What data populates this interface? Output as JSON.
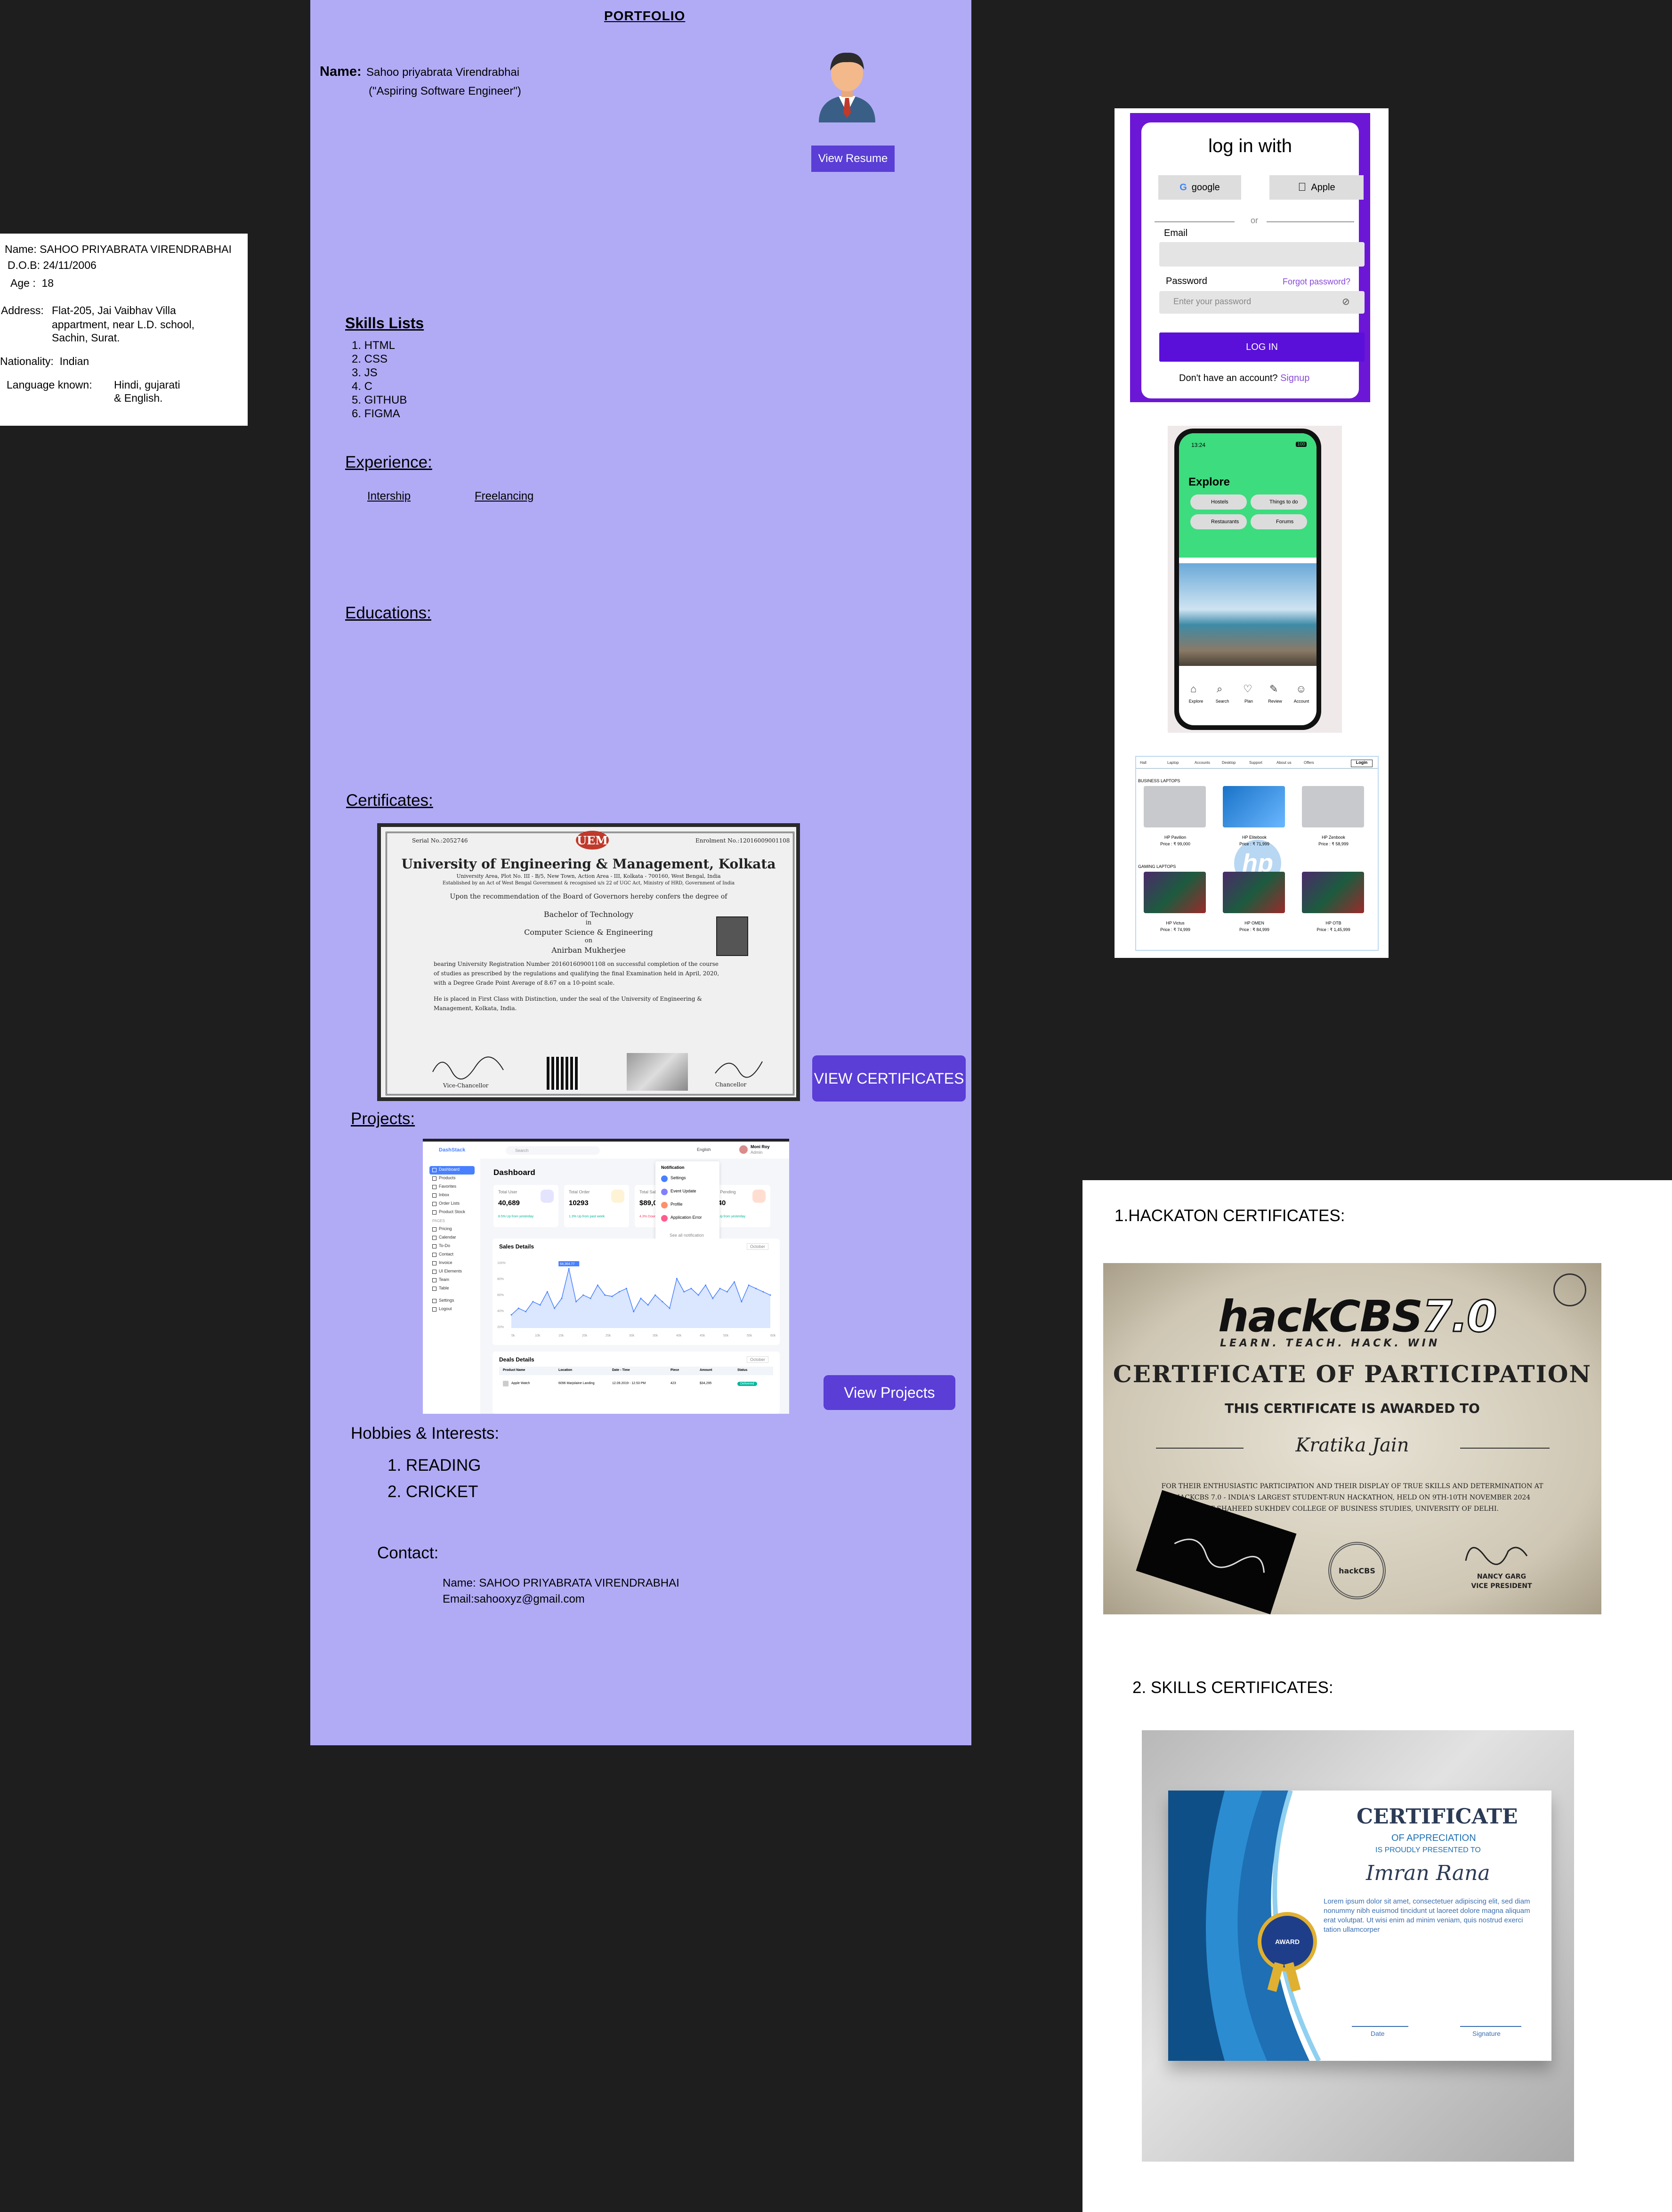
{
  "info": {
    "name_label": "Name:",
    "name_value": "SAHOO PRIYABRATA VIRENDRABHAI",
    "dob_label": "D.O.B:",
    "dob_value": "24/11/2006",
    "age_label": "Age :",
    "age_value": "18",
    "address_label": "Address:",
    "address_line1": "Flat-205, Jai Vaibhav Villa",
    "address_line2": "appartment, near L.D. school,",
    "address_line3": "Sachin, Surat.",
    "nationality_label": "Nationality:",
    "nationality_value": "Indian",
    "language_label": "Language known:",
    "language_line1": "Hindi, gujarati",
    "language_line2": "& English."
  },
  "portfolio": {
    "title": "PORTFOLIO",
    "name_label": "Name:",
    "name_value": "Sahoo priyabrata Virendrabhai",
    "tagline": "(\"Aspiring Software Engineer\")",
    "view_resume": "View Resume",
    "skills_heading": "Skills Lists",
    "skills": [
      "1. HTML",
      "2. CSS",
      "3. JS",
      "4. C",
      "5. GITHUB",
      "6. FIGMA"
    ],
    "experience_heading": "Experience:",
    "experience_items": [
      "Intership",
      "Freelancing"
    ],
    "education_heading": "Educations:",
    "certificates_heading": "Certificates:",
    "view_certificates": "VIEW CERTIFICATES",
    "projects_heading": "Projects:",
    "view_projects": "View Projects",
    "hobbies_heading": "Hobbies & Interests:",
    "hobbies": [
      "1. READING",
      "2. CRICKET"
    ],
    "contact_heading": "Contact:",
    "contact_name": "Name: SAHOO PRIYABRATA VIRENDRABHAI",
    "contact_email": "Email:sahooxyz@gmail.com"
  },
  "uem_certificate": {
    "logo": "UEM",
    "serial": "Serial No.:2052746",
    "enrolment": "Enrolment No.:12016009001108",
    "university": "University of Engineering & Management, Kolkata",
    "address": "University Area, Plot No. III - B/5, New Town, Action Area - III, Kolkata - 700160, West Bengal, India",
    "established": "Established by an Act of West Bengal Government & recognised u/s 22 of UGC Act, Ministry of HRD, Government of India",
    "recommendation": "Upon the recommendation of the Board of Governors hereby confers the degree of",
    "degree": "Bachelor of Technology",
    "in": "in",
    "discipline": "Computer Science & Engineering",
    "on": "on",
    "recipient": "Anirban Mukherjee",
    "body1": "bearing University Registration Number 201601609001108 on successful completion of the course",
    "body2": "of studies as prescribed by the regulations and qualifying the final Examination held in April, 2020,",
    "body3": "with a Degree Grade Point Average of 8.67 on a 10-point scale.",
    "body4": "He is placed in First Class with Distinction, under the seal of the University of Engineering &",
    "body5": "Management, Kolkata, India.",
    "sig_left": "Vice-Chancellor",
    "sig_right": "Chancellor"
  },
  "dashboard": {
    "brand": "DashStack",
    "search_placeholder": "Search",
    "language": "English",
    "user_name": "Moni Roy",
    "user_role": "Admin",
    "title": "Dashboard",
    "nav_items": [
      "Dashboard",
      "Products",
      "Favorites",
      "Inbox",
      "Order Lists",
      "Product Stock",
      "Pricing",
      "Calendar",
      "To-Do",
      "Contact",
      "Invoice",
      "UI Elements",
      "Team",
      "Table",
      "Settings",
      "Logout"
    ],
    "nav_section": "PAGES",
    "stats": [
      {
        "label": "Total User",
        "value": "40,689",
        "note": "8.5% Up from yesterday"
      },
      {
        "label": "Total Order",
        "value": "10293",
        "note": "1.3% Up from past week"
      },
      {
        "label": "Total Sales",
        "value": "$89,000",
        "note": "4.3% Down from yesterday"
      },
      {
        "label": "Total Pending",
        "value": "2040",
        "note": "1.8% Up from yesterday"
      }
    ],
    "notifications_title": "Notification",
    "notifications": [
      "Settings",
      "Event Update",
      "Profile",
      "Application Error"
    ],
    "notifications_footer": "See all notification",
    "sales_title": "Sales Details",
    "sales_filter": "October",
    "sales_badge": "64,364.77",
    "chart_data": {
      "type": "area",
      "y": [
        20,
        30,
        25,
        40,
        35,
        55,
        30,
        45,
        90,
        40,
        50,
        45,
        65,
        50,
        48,
        55,
        60,
        25,
        45,
        35,
        50,
        40,
        30,
        75,
        55,
        60,
        50,
        65,
        45,
        60,
        55,
        70,
        40,
        65,
        60,
        55,
        50
      ],
      "x_ticks": [
        "5k",
        "10k",
        "15k",
        "20k",
        "25k",
        "30k",
        "35k",
        "40k",
        "45k",
        "50k",
        "55k",
        "60k"
      ],
      "y_ticks": [
        "100%",
        "80%",
        "60%",
        "40%",
        "20%"
      ]
    },
    "deals_title": "Deals Details",
    "deals_filter": "October",
    "deals_headers": [
      "Product Name",
      "Location",
      "Date - Time",
      "Piece",
      "Amount",
      "Status"
    ],
    "deals_row": [
      "Apple Watch",
      "6096 Marjolaine Landing",
      "12.09.2019 - 12.53 PM",
      "423",
      "$34,295",
      "Delivered"
    ]
  },
  "login": {
    "title": "log in with",
    "google": "google",
    "apple": "Apple",
    "or": "or",
    "email_label": "Email",
    "password_label": "Password",
    "forgot": "Forgot password?",
    "password_placeholder": "Enter your password",
    "login_button": "LOG IN",
    "no_account": "Don't have an account?",
    "signup": "Signup"
  },
  "phone": {
    "time": "13:24",
    "battery": "100",
    "explore": "Explore",
    "chips": [
      "Hostels",
      "Things to do",
      "Restaurants",
      "Forums"
    ],
    "tabs": [
      "Explore",
      "Search",
      "Plan",
      "Review",
      "Account"
    ]
  },
  "laptops": {
    "nav": [
      "Hall",
      "Laptop",
      "Accounts",
      "Desktop",
      "Support",
      "About us",
      "Offers"
    ],
    "login": "Login",
    "business_heading": "BUSINESS LAPTOPS",
    "gaming_heading": "GAMING LAPTOPS",
    "business": [
      {
        "name": "HP Pavilion",
        "price": "Price : ₹ 99,000"
      },
      {
        "name": "HP Elitebook",
        "price": "Price : ₹ 71,999"
      },
      {
        "name": "HP Zenbook",
        "price": "Price : ₹ 58,999"
      }
    ],
    "gaming": [
      {
        "name": "HP Victus",
        "price": "Price : ₹ 74,999"
      },
      {
        "name": "HP OMEN",
        "price": "Price : ₹ 84,999"
      },
      {
        "name": "HP OTB",
        "price": "Price : ₹ 1,45,999"
      }
    ],
    "watermark": "hp"
  },
  "hackathon": {
    "section_title": "1.HACKATON CERTIFICATES:",
    "logo": "hackCBS",
    "logo_version": "7.0",
    "slogan": "LEARN. TEACH. HACK. WIN",
    "cert_title": "CERTIFICATE OF PARTICIPATION",
    "awarded_to": "THIS CERTIFICATE IS AWARDED TO",
    "recipient": "Kratika Jain",
    "body1": "FOR THEIR ENTHUSIASTIC PARTICIPATION AND THEIR DISPLAY OF TRUE SKILLS AND DETERMINATION AT",
    "body2": "HACKCBS 7.0 - INDIA'S LARGEST STUDENT-RUN HACKATHON, HELD ON 9TH-10TH NOVEMBER 2024",
    "body3": "AT SHAHEED SUKHDEV COLLEGE OF BUSINESS STUDIES, UNIVERSITY OF DELHI.",
    "signer_name": "NANCY GARG",
    "signer_role": "VICE PRESIDENT",
    "seal_text": "hackCBS"
  },
  "skills_cert": {
    "section_title": "2. SKILLS CERTIFICATES:",
    "title": "CERTIFICATE",
    "subtitle": "OF APPRECIATION",
    "presented": "IS PROUDLY PRESENTED TO",
    "recipient": "Imran Rana",
    "body": "Lorem ipsum dolor sit amet, consectetuer adipiscing elit, sed diam nonummy nibh euismod tincidunt ut laoreet dolore magna aliquam erat volutpat. Ut wisi enim ad minim veniam, quis nostrud exerci tation ullamcorper",
    "award": "AWARD",
    "date": "Date",
    "signature": "Signature"
  }
}
